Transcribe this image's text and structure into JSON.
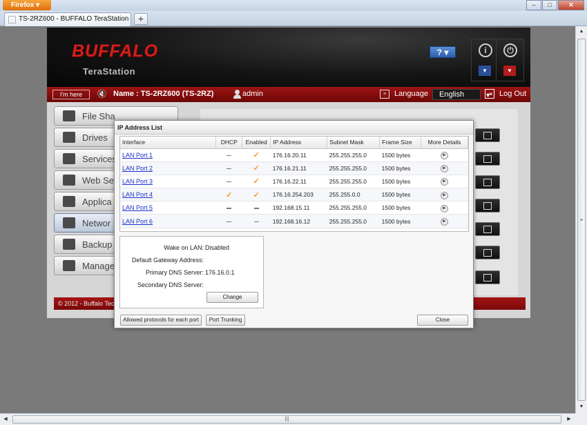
{
  "browser": {
    "app_button": "Firefox",
    "tab_title": "TS-2RZ600 - BUFFALO TeraStation",
    "new_tab": "+",
    "window_buttons": {
      "minimize": "‒",
      "maximize": "□",
      "close": "✕"
    }
  },
  "header": {
    "logo": "BUFFALO",
    "product": "TeraStation",
    "help_label": "? ▾",
    "info_icon": "i",
    "power_icon": "⏻"
  },
  "toolbar": {
    "im_here": "I'm here",
    "name_text": "Name : TS-2RZ600 (TS-2RZ)",
    "user": "admin",
    "language_label": "Language",
    "language_value": "English",
    "logout": "Log Out"
  },
  "menu": {
    "items": [
      {
        "label": "File Sha"
      },
      {
        "label": "Drives"
      },
      {
        "label": "Services"
      },
      {
        "label": "Web Se"
      },
      {
        "label": "Applica"
      },
      {
        "label": "Networ"
      },
      {
        "label": "Backup"
      },
      {
        "label": "Manage"
      }
    ]
  },
  "footer": {
    "copyright": "© 2012 - Buffalo Tech"
  },
  "dialog": {
    "title": "IP Address List",
    "columns": [
      "Interface",
      "DHCP",
      "Enabled",
      "IP Address",
      "Subnet Mask",
      "Frame Size",
      "More Details"
    ],
    "rows": [
      {
        "interface": "LAN Port 1",
        "dhcp": false,
        "enabled": true,
        "ip": "176.16.20.11",
        "mask": "255.255.255.0",
        "frame": "1500 bytes"
      },
      {
        "interface": "LAN Port 2",
        "dhcp": false,
        "enabled": true,
        "ip": "176.16.21.11",
        "mask": "255.255.255.0",
        "frame": "1500 bytes"
      },
      {
        "interface": "LAN Port 3",
        "dhcp": false,
        "enabled": true,
        "ip": "176.16.22.11",
        "mask": "255.255.255.0",
        "frame": "1500 bytes"
      },
      {
        "interface": "LAN Port 4",
        "dhcp": true,
        "enabled": true,
        "ip": "176.16.254.203",
        "mask": "255.255.0.0",
        "frame": "1500 bytes"
      },
      {
        "interface": "LAN Port 5",
        "dhcp": false,
        "enabled": false,
        "ip": "192.168.15.11",
        "mask": "255.255.255.0",
        "frame": "1500 bytes"
      },
      {
        "interface": "LAN Port 6",
        "dhcp": false,
        "enabled": false,
        "ip": "192.168.16.12",
        "mask": "255.255.255.0",
        "frame": "1500 bytes"
      }
    ],
    "info": {
      "wol_label": "Wake on LAN:",
      "wol_value": "Disabled",
      "gateway_label": "Default Gateway Address:",
      "gateway_value": "",
      "dns1_label": "Primary DNS Server:",
      "dns1_value": "176.16.0.1",
      "dns2_label": "Secondary DNS Server:",
      "dns2_value": ""
    },
    "change_button": "Change",
    "allowed_protocols_button": "Allowed protocols for each port",
    "port_trunking_button": "Port Trunking",
    "close_button": "Close"
  },
  "colors": {
    "accent_red": "#9c1414",
    "link_blue": "#1a2fcc",
    "check_orange": "#f09d1c"
  }
}
